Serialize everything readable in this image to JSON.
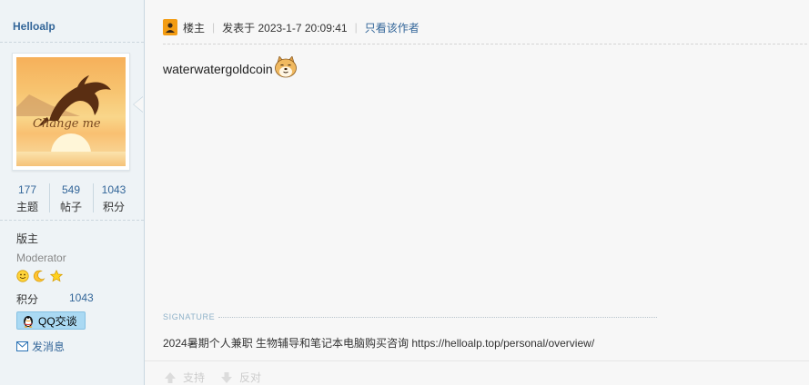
{
  "author": {
    "username": "Helloalp",
    "avatar_caption": "Change me",
    "stats": [
      {
        "value": "177",
        "label": "主题"
      },
      {
        "value": "549",
        "label": "帖子"
      },
      {
        "value": "1043",
        "label": "积分"
      }
    ],
    "role": "版主",
    "role_en": "Moderator",
    "medals": [
      "smiley-medal-icon",
      "moon-medal-icon",
      "star-medal-icon"
    ],
    "jifen_label": "积分",
    "jifen_value": "1043",
    "qq_label": "QQ交谈",
    "message_label": "发消息"
  },
  "post": {
    "owner_label": "楼主",
    "posted_at": "发表于 2023-1-7 20:09:41",
    "only_author_label": "只看该作者",
    "content": "waterwatergoldcoin",
    "emoji": "doge-emoji-icon",
    "signature_label": "SIGNATURE",
    "signature_text": "2024暑期个人兼职 生物辅导和笔记本电脑购买咨询 https://helloalp.top/personal/overview/",
    "support_label": "支持",
    "oppose_label": "反对"
  },
  "colors": {
    "link": "#336699",
    "sidebar_bg": "#eef3f6",
    "page_bg": "#f7f7f7",
    "qq_button": "#aad9f3",
    "signature_label": "#8fb2c9"
  }
}
